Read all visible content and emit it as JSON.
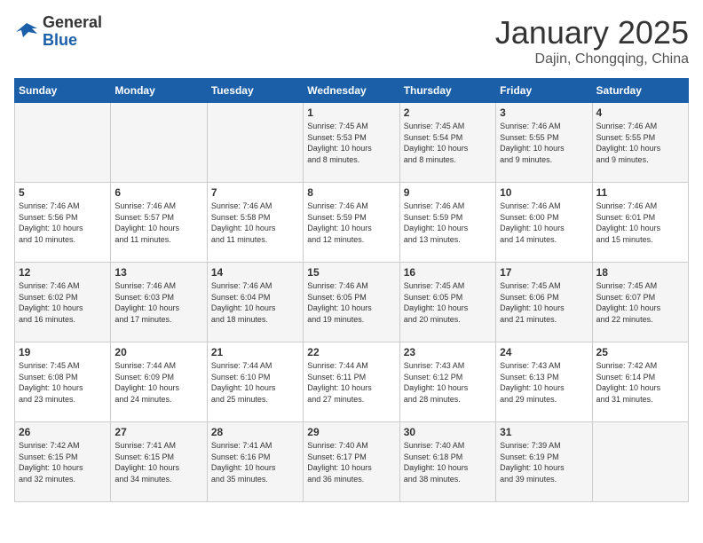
{
  "header": {
    "logo_general": "General",
    "logo_blue": "Blue",
    "title": "January 2025",
    "subtitle": "Dajin, Chongqing, China"
  },
  "weekdays": [
    "Sunday",
    "Monday",
    "Tuesday",
    "Wednesday",
    "Thursday",
    "Friday",
    "Saturday"
  ],
  "weeks": [
    [
      {
        "day": "",
        "info": ""
      },
      {
        "day": "",
        "info": ""
      },
      {
        "day": "",
        "info": ""
      },
      {
        "day": "1",
        "info": "Sunrise: 7:45 AM\nSunset: 5:53 PM\nDaylight: 10 hours\nand 8 minutes."
      },
      {
        "day": "2",
        "info": "Sunrise: 7:45 AM\nSunset: 5:54 PM\nDaylight: 10 hours\nand 8 minutes."
      },
      {
        "day": "3",
        "info": "Sunrise: 7:46 AM\nSunset: 5:55 PM\nDaylight: 10 hours\nand 9 minutes."
      },
      {
        "day": "4",
        "info": "Sunrise: 7:46 AM\nSunset: 5:55 PM\nDaylight: 10 hours\nand 9 minutes."
      }
    ],
    [
      {
        "day": "5",
        "info": "Sunrise: 7:46 AM\nSunset: 5:56 PM\nDaylight: 10 hours\nand 10 minutes."
      },
      {
        "day": "6",
        "info": "Sunrise: 7:46 AM\nSunset: 5:57 PM\nDaylight: 10 hours\nand 11 minutes."
      },
      {
        "day": "7",
        "info": "Sunrise: 7:46 AM\nSunset: 5:58 PM\nDaylight: 10 hours\nand 11 minutes."
      },
      {
        "day": "8",
        "info": "Sunrise: 7:46 AM\nSunset: 5:59 PM\nDaylight: 10 hours\nand 12 minutes."
      },
      {
        "day": "9",
        "info": "Sunrise: 7:46 AM\nSunset: 5:59 PM\nDaylight: 10 hours\nand 13 minutes."
      },
      {
        "day": "10",
        "info": "Sunrise: 7:46 AM\nSunset: 6:00 PM\nDaylight: 10 hours\nand 14 minutes."
      },
      {
        "day": "11",
        "info": "Sunrise: 7:46 AM\nSunset: 6:01 PM\nDaylight: 10 hours\nand 15 minutes."
      }
    ],
    [
      {
        "day": "12",
        "info": "Sunrise: 7:46 AM\nSunset: 6:02 PM\nDaylight: 10 hours\nand 16 minutes."
      },
      {
        "day": "13",
        "info": "Sunrise: 7:46 AM\nSunset: 6:03 PM\nDaylight: 10 hours\nand 17 minutes."
      },
      {
        "day": "14",
        "info": "Sunrise: 7:46 AM\nSunset: 6:04 PM\nDaylight: 10 hours\nand 18 minutes."
      },
      {
        "day": "15",
        "info": "Sunrise: 7:46 AM\nSunset: 6:05 PM\nDaylight: 10 hours\nand 19 minutes."
      },
      {
        "day": "16",
        "info": "Sunrise: 7:45 AM\nSunset: 6:05 PM\nDaylight: 10 hours\nand 20 minutes."
      },
      {
        "day": "17",
        "info": "Sunrise: 7:45 AM\nSunset: 6:06 PM\nDaylight: 10 hours\nand 21 minutes."
      },
      {
        "day": "18",
        "info": "Sunrise: 7:45 AM\nSunset: 6:07 PM\nDaylight: 10 hours\nand 22 minutes."
      }
    ],
    [
      {
        "day": "19",
        "info": "Sunrise: 7:45 AM\nSunset: 6:08 PM\nDaylight: 10 hours\nand 23 minutes."
      },
      {
        "day": "20",
        "info": "Sunrise: 7:44 AM\nSunset: 6:09 PM\nDaylight: 10 hours\nand 24 minutes."
      },
      {
        "day": "21",
        "info": "Sunrise: 7:44 AM\nSunset: 6:10 PM\nDaylight: 10 hours\nand 25 minutes."
      },
      {
        "day": "22",
        "info": "Sunrise: 7:44 AM\nSunset: 6:11 PM\nDaylight: 10 hours\nand 27 minutes."
      },
      {
        "day": "23",
        "info": "Sunrise: 7:43 AM\nSunset: 6:12 PM\nDaylight: 10 hours\nand 28 minutes."
      },
      {
        "day": "24",
        "info": "Sunrise: 7:43 AM\nSunset: 6:13 PM\nDaylight: 10 hours\nand 29 minutes."
      },
      {
        "day": "25",
        "info": "Sunrise: 7:42 AM\nSunset: 6:14 PM\nDaylight: 10 hours\nand 31 minutes."
      }
    ],
    [
      {
        "day": "26",
        "info": "Sunrise: 7:42 AM\nSunset: 6:15 PM\nDaylight: 10 hours\nand 32 minutes."
      },
      {
        "day": "27",
        "info": "Sunrise: 7:41 AM\nSunset: 6:15 PM\nDaylight: 10 hours\nand 34 minutes."
      },
      {
        "day": "28",
        "info": "Sunrise: 7:41 AM\nSunset: 6:16 PM\nDaylight: 10 hours\nand 35 minutes."
      },
      {
        "day": "29",
        "info": "Sunrise: 7:40 AM\nSunset: 6:17 PM\nDaylight: 10 hours\nand 36 minutes."
      },
      {
        "day": "30",
        "info": "Sunrise: 7:40 AM\nSunset: 6:18 PM\nDaylight: 10 hours\nand 38 minutes."
      },
      {
        "day": "31",
        "info": "Sunrise: 7:39 AM\nSunset: 6:19 PM\nDaylight: 10 hours\nand 39 minutes."
      },
      {
        "day": "",
        "info": ""
      }
    ]
  ]
}
